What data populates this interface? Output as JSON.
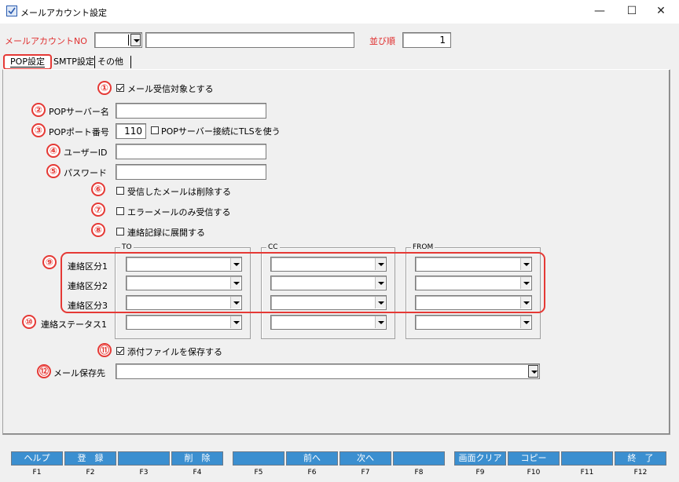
{
  "window": {
    "title": "メールアカウント設定",
    "min": "—",
    "max": "☐",
    "close": "✕"
  },
  "header": {
    "account_no_label": "メールアカウントNO",
    "account_no_value": "",
    "account_name_value": "",
    "order_label": "並び順",
    "order_value": "1"
  },
  "tabs": [
    "POP設定",
    "SMTP設定",
    "その他"
  ],
  "pop": {
    "receive_target": {
      "num": "①",
      "label": "メール受信対象とする",
      "checked": true
    },
    "server_name": {
      "num": "②",
      "label": "POPサーバー名",
      "value": ""
    },
    "port": {
      "num": "③",
      "label": "POPポート番号",
      "value": "110"
    },
    "tls": {
      "label": "POPサーバー接続にTLSを使う",
      "checked": false
    },
    "user_id": {
      "num": "④",
      "label": "ユーザーID",
      "value": ""
    },
    "password": {
      "num": "⑤",
      "label": "パスワード",
      "value": ""
    },
    "delete_received": {
      "num": "⑥",
      "label": "受信したメールは削除する",
      "checked": false
    },
    "error_only": {
      "num": "⑦",
      "label": "エラーメールのみ受信する",
      "checked": false
    },
    "expand_log": {
      "num": "⑧",
      "label": "連絡記録に展開する",
      "checked": false
    },
    "groups": {
      "to": "TO",
      "cc": "CC",
      "from": "FROM"
    },
    "category_num": "⑨",
    "categories": [
      "連絡区分1",
      "連絡区分2",
      "連絡区分3"
    ],
    "status_num": "⑩",
    "status_label": "連絡ステータス1",
    "save_attach": {
      "num": "⑪",
      "label": "添付ファイルを保存する",
      "checked": true
    },
    "save_dest": {
      "num": "⑫",
      "label": "メール保存先",
      "value": ""
    }
  },
  "fkeys": [
    {
      "label": "ヘルプ",
      "key": "F1"
    },
    {
      "label": "登　録",
      "key": "F2"
    },
    {
      "label": "",
      "key": "F3"
    },
    {
      "label": "削　除",
      "key": "F4"
    },
    {
      "label": "",
      "key": "F5"
    },
    {
      "label": "前へ",
      "key": "F6"
    },
    {
      "label": "次へ",
      "key": "F7"
    },
    {
      "label": "",
      "key": "F8"
    },
    {
      "label": "画面クリア",
      "key": "F9"
    },
    {
      "label": "コピー",
      "key": "F10"
    },
    {
      "label": "",
      "key": "F11"
    },
    {
      "label": "終　了",
      "key": "F12"
    }
  ],
  "colors": {
    "accent_red": "#e53935",
    "fkey_blue": "#3b8fd0"
  }
}
